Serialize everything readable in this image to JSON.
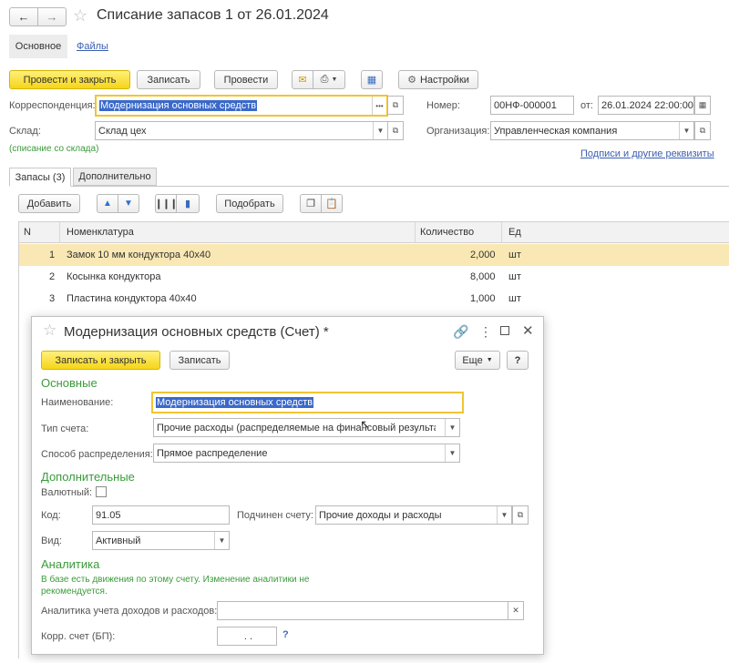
{
  "window": {
    "title": "Списание запасов 1 от 26.01.2024",
    "tabs": [
      "Основное",
      "Файлы"
    ]
  },
  "toolbar": {
    "post_close": "Провести и закрыть",
    "save": "Записать",
    "post": "Провести",
    "settings": "Настройки"
  },
  "form": {
    "corr_label": "Корреспонденция:",
    "corr_value": "Модернизация основных средств",
    "number_label": "Номер:",
    "number_value": "00НФ-000001",
    "date_sep": "от:",
    "date_value": "26.01.2024 22:00:00",
    "warehouse_label": "Склад:",
    "warehouse_value": "Склад цех",
    "org_label": "Организация:",
    "org_value": "Управленческая компания",
    "hint": "(списание со склада)",
    "signatures_link": "Подписи и другие реквизиты"
  },
  "doc_tabs": [
    "Запасы (3)",
    "Дополнительно"
  ],
  "grid_toolbar": {
    "add": "Добавить",
    "pick": "Подобрать"
  },
  "grid": {
    "headers": [
      "N",
      "Номенклатура",
      "Количество",
      "Ед"
    ],
    "rows": [
      {
        "n": "1",
        "name": "Замок 10 мм кондуктора 40х40",
        "qty": "2,000",
        "unit": "шт"
      },
      {
        "n": "2",
        "name": "Косынка кондуктора",
        "qty": "8,000",
        "unit": "шт"
      },
      {
        "n": "3",
        "name": "Пластина кондуктора 40х40",
        "qty": "1,000",
        "unit": "шт"
      }
    ]
  },
  "dialog": {
    "title": "Модернизация основных средств (Счет) *",
    "save_close": "Записать и закрыть",
    "save": "Записать",
    "more": "Еще",
    "help": "?",
    "section_main": "Основные",
    "name_label": "Наименование:",
    "name_value": "Модернизация основных средств",
    "acct_type_label": "Тип счета:",
    "acct_type_value": "Прочие расходы (распределяемые на финансовый результат)",
    "dist_label": "Способ распределения:",
    "dist_value": "Прямое распределение",
    "section_extra": "Дополнительные",
    "currency_label": "Валютный:",
    "code_label": "Код:",
    "code_value": "91.05",
    "parent_label": "Подчинен счету:",
    "parent_value": "Прочие доходы и расходы",
    "kind_label": "Вид:",
    "kind_value": "Активный",
    "section_analytics": "Аналитика",
    "analytics_note": "В базе есть движения по этому счету. Изменение аналитики не рекомендуется.",
    "analytics_label": "Аналитика учета доходов и расходов:",
    "corr_acct_label": "Корр. счет (БП):",
    "corr_acct_value": ". .",
    "qmark": "?"
  }
}
